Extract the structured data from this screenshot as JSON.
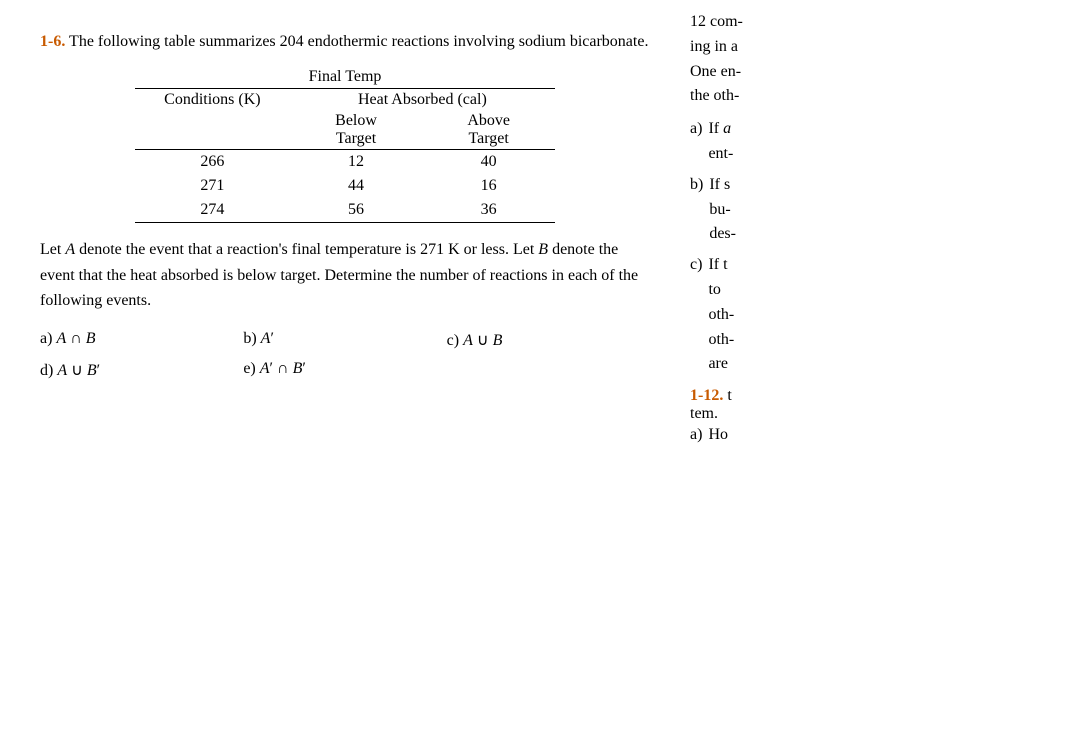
{
  "left": {
    "problem_number": "1-6.",
    "intro": "The following table summarizes 204 endothermic reactions involving sodium bicarbonate.",
    "table": {
      "col1_header1": "Final Temp",
      "col1_header2": "Conditions (K)",
      "col2_header1": "Heat Absorbed (cal)",
      "col2_sub1": "Below",
      "col2_sub1b": "Target",
      "col2_sub2": "Above",
      "col2_sub2b": "Target",
      "rows": [
        {
          "conditions": "266",
          "below": "12",
          "above": "40"
        },
        {
          "conditions": "271",
          "below": "44",
          "above": "16"
        },
        {
          "conditions": "274",
          "below": "56",
          "above": "36"
        }
      ]
    },
    "description": "Let A denote the event that a reaction’s final temperature is 271 K or less. Let B denote the event that the heat absorbed is below target. Determine the number of reactions in each of the following events.",
    "answers": [
      {
        "label": "a)",
        "expr": "A ∩ B"
      },
      {
        "label": "b)",
        "expr": "A′"
      },
      {
        "label": "c)",
        "expr": "A ∪ B"
      },
      {
        "label": "d)",
        "expr": "A ∪ B′"
      },
      {
        "label": "e)",
        "expr": "A′ ∩ B′"
      }
    ]
  },
  "right": {
    "top_text_lines": [
      "12 com-",
      "ing in a",
      "One en-",
      "the oth-"
    ],
    "sub_items": [
      {
        "label": "a)",
        "prefix": "If ",
        "suffix": "ent-",
        "clipped": true
      },
      {
        "label": "b)",
        "prefix": "If s",
        "suffix_lines": [
          "bu-",
          "des-"
        ],
        "clipped": true
      },
      {
        "label": "c)",
        "prefix": "If t",
        "suffix_lines": [
          "to",
          "oth-",
          "oth-",
          "are"
        ],
        "clipped": true
      }
    ],
    "problem_1_12": {
      "number": "1-12.",
      "text": "t",
      "line2": "tem.",
      "sub_a_label": "a)",
      "sub_a_text": "Ho"
    }
  }
}
